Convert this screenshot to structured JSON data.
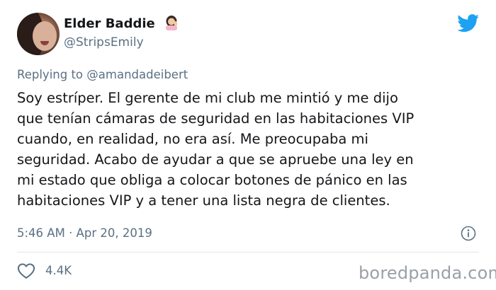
{
  "author": {
    "display_name": "Elder Baddie",
    "name_emoji": "person-tipping-hand-emoji",
    "handle": "@StripsEmily"
  },
  "reply": {
    "prefix": "Replying to ",
    "mention": "@amandadeibert"
  },
  "tweet": {
    "lines": [
      "Soy estríper. El gerente de mi club me mintió y me dijo",
      "que tenían cámaras de seguridad en las habitaciones VIP",
      "cuando, en realidad, no era así. Me preocupaba mi",
      "seguridad. Acabo de ayudar a que se apruebe una ley en",
      "mi estado que obliga a colocar botones de pánico en las",
      "habitaciones VIP y a tener una lista negra de clientes."
    ]
  },
  "meta": {
    "timestamp": "5:46 AM · Apr 20, 2019"
  },
  "stats": {
    "likes": "4.4K"
  },
  "watermark": "boredpanda.com",
  "colors": {
    "text": "#141619",
    "secondary": "#5b7083",
    "twitter_blue": "#1da1f2",
    "divider": "#e1e8ed"
  }
}
